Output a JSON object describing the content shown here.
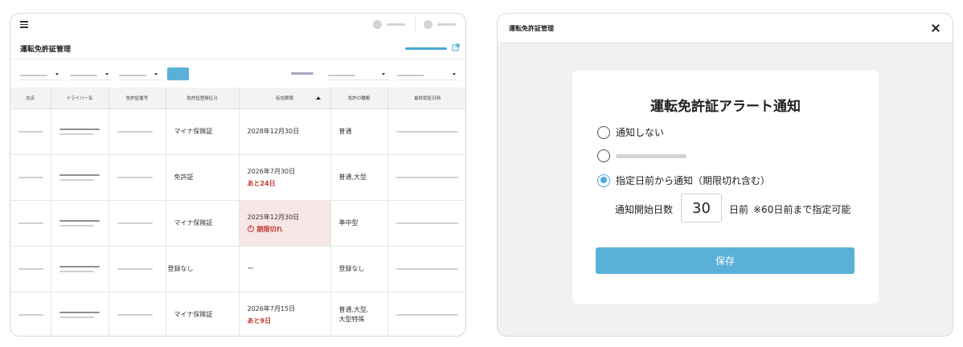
{
  "left": {
    "title": "運転免許証管理",
    "table": {
      "headers": [
        "支店",
        "ドライバー名",
        "免許証番号",
        "免許証登録区分",
        "有効期限",
        "免許の種類",
        "最終認証日時"
      ],
      "rows": [
        {
          "category": "マイナ保険証",
          "expiry": "2028年12月30日",
          "expiry_note": "",
          "expired_label": "",
          "license_type": "普通"
        },
        {
          "category": "免許証",
          "expiry": "2026年7月30日",
          "expiry_note": "あと24日",
          "expired_label": "",
          "license_type": "普通,大型"
        },
        {
          "category": "マイナ保険証",
          "expiry": "2025年12月30日",
          "expiry_note": "",
          "expired_label": "期限切れ",
          "license_type": "準中型"
        },
        {
          "category": "登録なし",
          "expiry": "ー",
          "expiry_note": "",
          "expired_label": "",
          "license_type": "登録なし"
        },
        {
          "category": "マイナ保険証",
          "expiry": "2026年7月15日",
          "expiry_note": "あと9日",
          "expired_label": "",
          "license_type": "普通,大型,\n大型特殊"
        }
      ]
    }
  },
  "modal": {
    "header_title": "運転免許証管理",
    "title": "運転免許証アラート通知",
    "options": {
      "none": "通知しない",
      "days_before": "指定日前から通知（期限切れ含む）"
    },
    "selected_option": "days_before",
    "start_days_label": "通知開始日数",
    "start_days_value": "30",
    "start_days_unit": "日前",
    "start_days_note": "※60日前まで指定可能",
    "save_label": "保存"
  },
  "colors": {
    "accent": "#5ab0d9",
    "expired_bg": "#f6e6e6",
    "warning_text": "#c0392b"
  }
}
